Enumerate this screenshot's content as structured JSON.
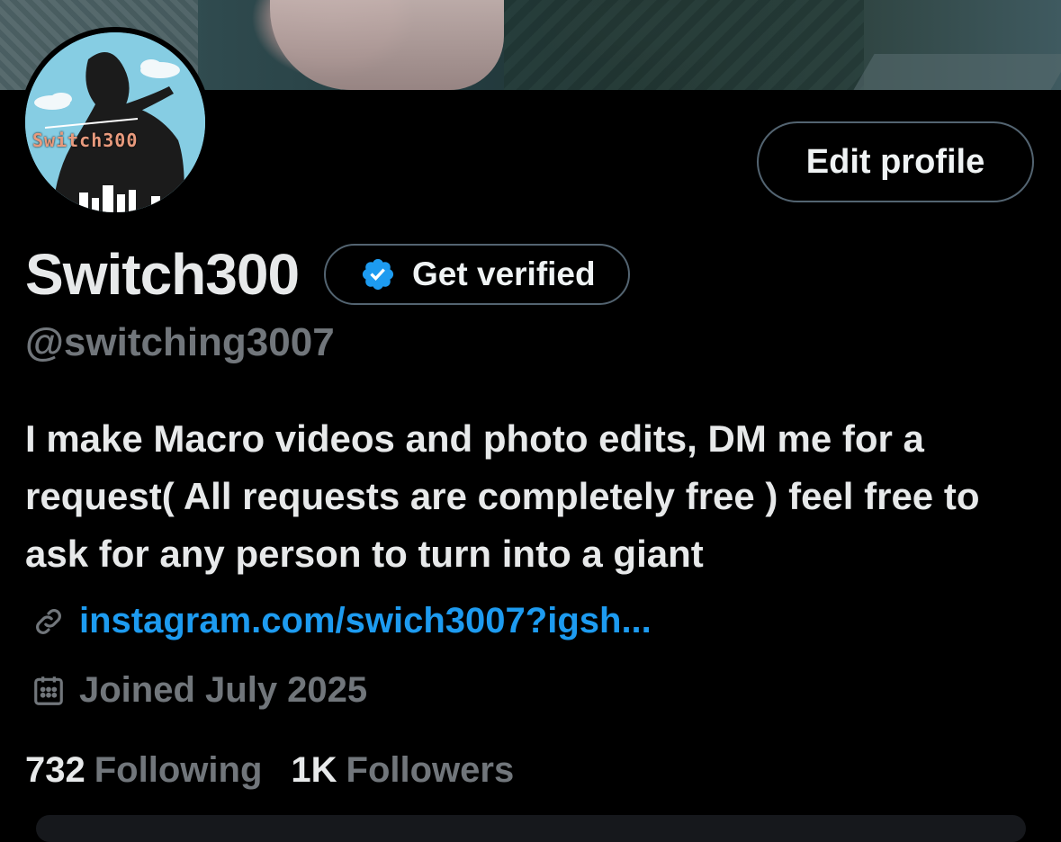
{
  "profile": {
    "display_name": "Switch300",
    "handle": "@switching3007",
    "avatar_text": "Switch300",
    "bio": "I make Macro videos and photo edits, DM me for a request( All requests are completely free ) feel free to ask for any person to turn into a giant",
    "link": "instagram.com/swich3007?igsh...",
    "joined": "Joined July 2025"
  },
  "buttons": {
    "edit_profile": "Edit profile",
    "get_verified": "Get verified"
  },
  "stats": {
    "following_count": "732",
    "following_label": "Following",
    "followers_count": "1K",
    "followers_label": "Followers"
  },
  "colors": {
    "background": "#000000",
    "text_primary": "#e7e9ea",
    "text_secondary": "#71767b",
    "link": "#1d9bf0",
    "verified_badge": "#1d9bf0",
    "border": "#536471"
  },
  "icons": {
    "verified": "verified-badge-icon",
    "link": "link-icon",
    "calendar": "calendar-icon"
  }
}
